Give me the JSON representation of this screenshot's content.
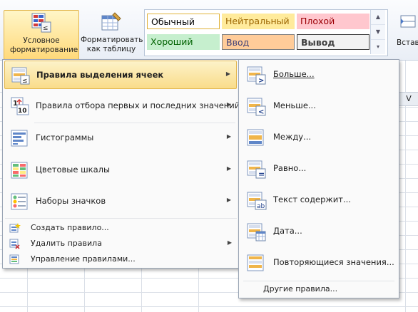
{
  "ribbon": {
    "cond_format_label": "Условное форматирование",
    "format_table_label": "Форматировать как таблицу",
    "insert_label": "Вставить",
    "styles": [
      {
        "label": "Обычный",
        "bg": "#ffffff",
        "fg": "#000000",
        "border": "#c9a100"
      },
      {
        "label": "Нейтральный",
        "bg": "#ffeb9c",
        "fg": "#9c6500",
        "border": "#ffeb9c"
      },
      {
        "label": "Плохой",
        "bg": "#ffc7ce",
        "fg": "#9c0006",
        "border": "#ffc7ce"
      },
      {
        "label": "Хороший",
        "bg": "#c6efce",
        "fg": "#006100",
        "border": "#c6efce"
      },
      {
        "label": "Ввод",
        "bg": "#ffcc99",
        "fg": "#3f3f76",
        "border": "#7f7f7f"
      },
      {
        "label": "Вывод",
        "bg": "#f2f2f2",
        "fg": "#3f3f3f",
        "border": "#3f3f3f"
      }
    ]
  },
  "sheet": {
    "column_letter": "V"
  },
  "main_menu": {
    "items": [
      {
        "label": "Правила выделения ячеек",
        "highlighted": true
      },
      {
        "label": "Правила отбора первых и последних значений"
      },
      {
        "label": "Гистограммы"
      },
      {
        "label": "Цветовые шкалы"
      },
      {
        "label": "Наборы значков"
      }
    ],
    "small_items": [
      {
        "label": "Создать правило..."
      },
      {
        "label": "Удалить правила"
      },
      {
        "label": "Управление правилами..."
      }
    ]
  },
  "sub_menu": {
    "items": [
      {
        "label": "Больше...",
        "glyph": ">"
      },
      {
        "label": "Меньше...",
        "glyph": "<"
      },
      {
        "label": "Между...",
        "glyph": "↔"
      },
      {
        "label": "Равно...",
        "glyph": "="
      },
      {
        "label": "Текст содержит...",
        "glyph": "ab"
      },
      {
        "label": "Дата...",
        "glyph": "▦"
      },
      {
        "label": "Повторяющиеся значения...",
        "glyph": "≡"
      }
    ],
    "more_rules": "Другие правила..."
  },
  "colors": {
    "highlight_top": "#fdf2c9",
    "highlight_bottom": "#f9dc8a",
    "accent": "#e3b74f"
  }
}
